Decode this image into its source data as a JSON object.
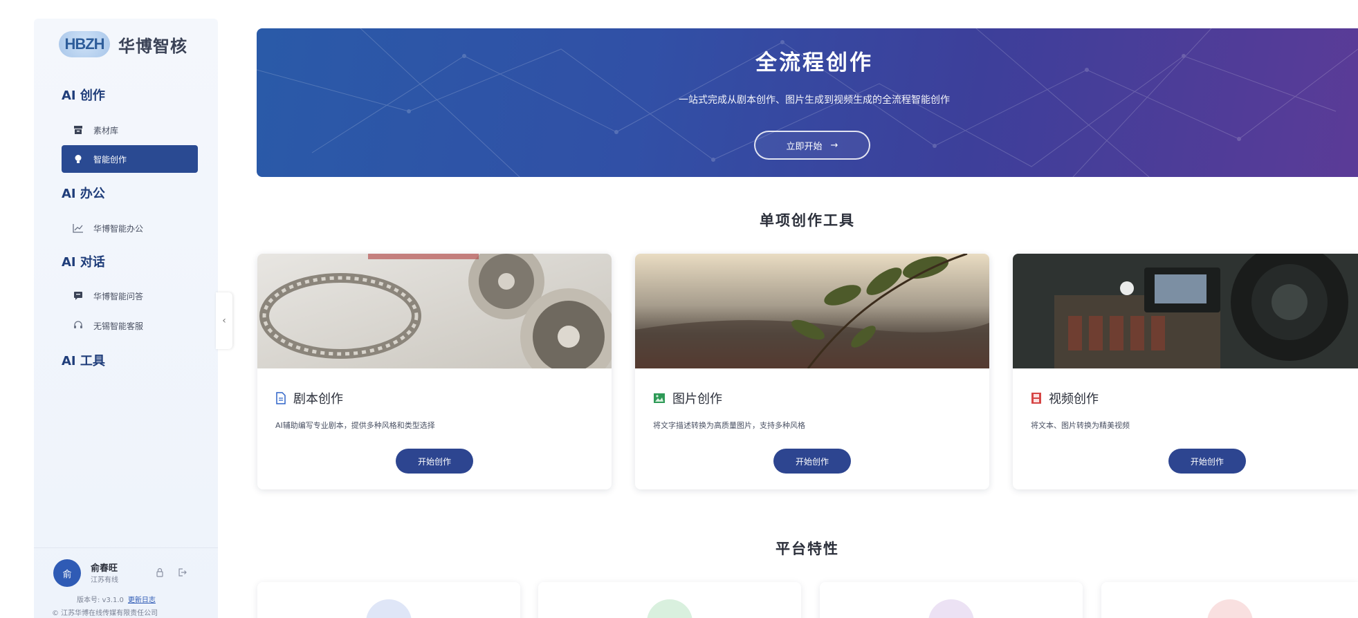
{
  "brand": {
    "mark": "HBZH",
    "name": "华博智核"
  },
  "sidebar": {
    "groups": [
      {
        "label": "AI 创作"
      },
      {
        "label": "AI 办公"
      },
      {
        "label": "AI 对话"
      },
      {
        "label": "AI 工具"
      }
    ],
    "items": [
      {
        "label": "素材库",
        "icon": "archive-icon"
      },
      {
        "label": "智能创作",
        "icon": "lightbulb-icon",
        "active": true
      },
      {
        "label": "华博智能办公",
        "icon": "chart-line-icon"
      },
      {
        "label": "华博智能问答",
        "icon": "chat-icon"
      },
      {
        "label": "无锡智能客服",
        "icon": "headset-icon"
      }
    ],
    "collapse_glyph": "‹"
  },
  "user": {
    "avatar": "俞",
    "name": "俞春旺",
    "org": "江苏有线",
    "version_label": "版本号: v3.1.0",
    "changelog_link": "更新日志",
    "copyright": "© 江苏华博在线传媒有限责任公司"
  },
  "hero": {
    "title": "全流程创作",
    "subtitle": "一站式完成从剧本创作、图片生成到视频生成的全流程智能创作",
    "button_label": "立即开始",
    "button_arrow": "→"
  },
  "sections": {
    "tools_title": "单项创作工具",
    "features_title": "平台特性"
  },
  "tools": [
    {
      "title": "剧本创作",
      "icon": "document-icon",
      "icon_color": "#2f63c8",
      "description": "AI辅助编写专业剧本，提供多种风格和类型选择",
      "button_label": "开始创作"
    },
    {
      "title": "图片创作",
      "icon": "image-icon",
      "icon_color": "#2e9a57",
      "description": "将文字描述转换为高质量图片，支持多种风格",
      "button_label": "开始创作"
    },
    {
      "title": "视频创作",
      "icon": "film-icon",
      "icon_color": "#d64545",
      "description": "将文本、图片转换为精美视频",
      "button_label": "开始创作"
    }
  ],
  "features": [
    {
      "color": "#dfe6f7"
    },
    {
      "color": "#d9f0de"
    },
    {
      "color": "#ece2f4"
    },
    {
      "color": "#f9e0e0"
    }
  ],
  "colors": {
    "accent": "#2a4a92",
    "hero_start": "#2a5aa8",
    "hero_end": "#5b3b97",
    "button": "#2d4590"
  }
}
